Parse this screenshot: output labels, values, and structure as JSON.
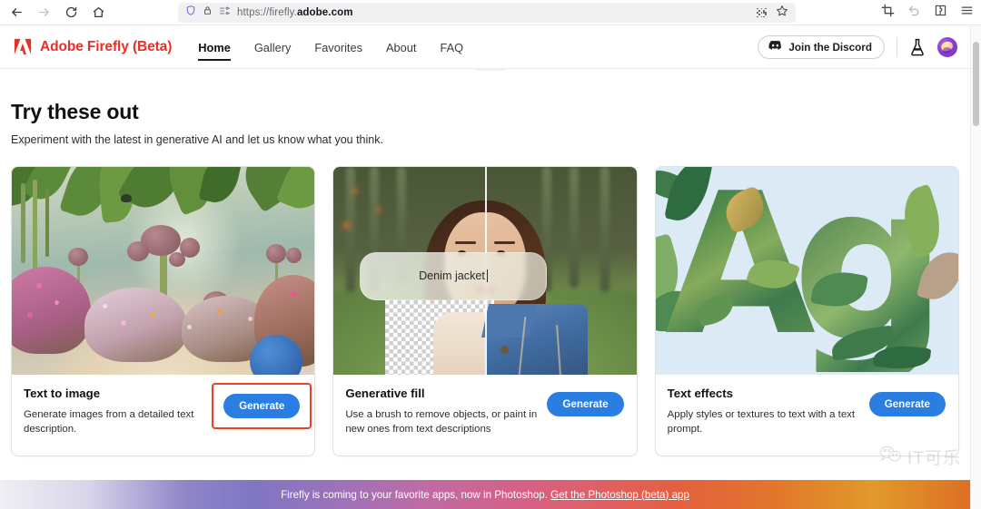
{
  "browser": {
    "back_icon": "back-arrow-icon",
    "forward_icon": "forward-arrow-icon",
    "reload_icon": "reload-icon",
    "home_icon": "home-icon",
    "shield_icon": "shield-icon",
    "lock_icon": "lock-icon",
    "reader_icon": "reader-view-icon",
    "url_prefix": "https://firefly.",
    "url_domain": "adobe.com",
    "qr_icon": "qr-code-icon",
    "bookmark_icon": "star-bookmark-icon",
    "screenshot_icon": "crop-screenshot-icon",
    "undo_icon": "undo-icon",
    "extension_icon": "extension-icon",
    "menu_icon": "hamburger-menu-icon"
  },
  "site_header": {
    "brand": "Adobe Firefly (Beta)",
    "nav": [
      {
        "label": "Home",
        "active": true
      },
      {
        "label": "Gallery",
        "active": false
      },
      {
        "label": "Favorites",
        "active": false
      },
      {
        "label": "About",
        "active": false
      },
      {
        "label": "FAQ",
        "active": false
      }
    ],
    "discord_button": "Join the Discord",
    "discord_icon": "discord-logo-icon",
    "beta_icon": "flask-beaker-icon",
    "avatar": "user-avatar"
  },
  "main": {
    "title": "Try these out",
    "subtitle": "Experiment with the latest in generative AI and let us know what you think.",
    "cards": [
      {
        "title": "Text to image",
        "description": "Generate images from a detailed text description.",
        "button": "Generate",
        "highlighted": true,
        "media": "fantasy-garden-image"
      },
      {
        "title": "Generative fill",
        "description": "Use a brush to remove objects, or paint in new ones from text descriptions",
        "button": "Generate",
        "highlighted": false,
        "media": "portrait-denim-jacket-image",
        "prompt_overlay": "Denim jacket"
      },
      {
        "title": "Text effects",
        "description": "Apply styles or textures to text with a text prompt.",
        "button": "Generate",
        "highlighted": false,
        "media": "leafy-letters-image",
        "letters": "Ag"
      }
    ]
  },
  "banner": {
    "text": "Firefly is coming to your favorite apps, now in Photoshop. ",
    "link": "Get the Photoshop (beta) app"
  },
  "watermark": {
    "icon": "wechat-icon",
    "text": "IT可乐"
  },
  "colors": {
    "brand_red": "#eb2f26",
    "generate_blue": "#2a7de1",
    "highlight_red": "#ef3d28"
  }
}
